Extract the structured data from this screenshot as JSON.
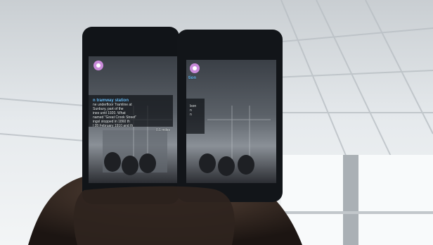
{
  "scene": {
    "description_tag": "two smartphones held side by side showing an augmented-reality view",
    "icons": [
      "ar-marker-icon",
      "ar-marker-icon"
    ]
  },
  "left_phone": {
    "overlay_title": "n tramway station",
    "overlay_lines": [
      "ne underfloor Tramline at",
      "Sunbury, part of the",
      "ines until 1920. What",
      "named \"Great Crook Street\"",
      "ingsl stopped in 1860 th",
      "l 28 February 1910 and th"
    ],
    "overlay_footer": "0.1 miles"
  },
  "right_phone": {
    "overlay_title": "tion",
    "overlay_lines": [
      "lson",
      "n",
      "n"
    ],
    "overlay_footer": ""
  },
  "colors": {
    "ceiling": "#e9eef0",
    "phone_body": "#111418",
    "screen_dark": "#2b3038",
    "marker": "#c98ad9",
    "overlay_title": "#6ec3ff",
    "hand": "#3a2c24"
  }
}
